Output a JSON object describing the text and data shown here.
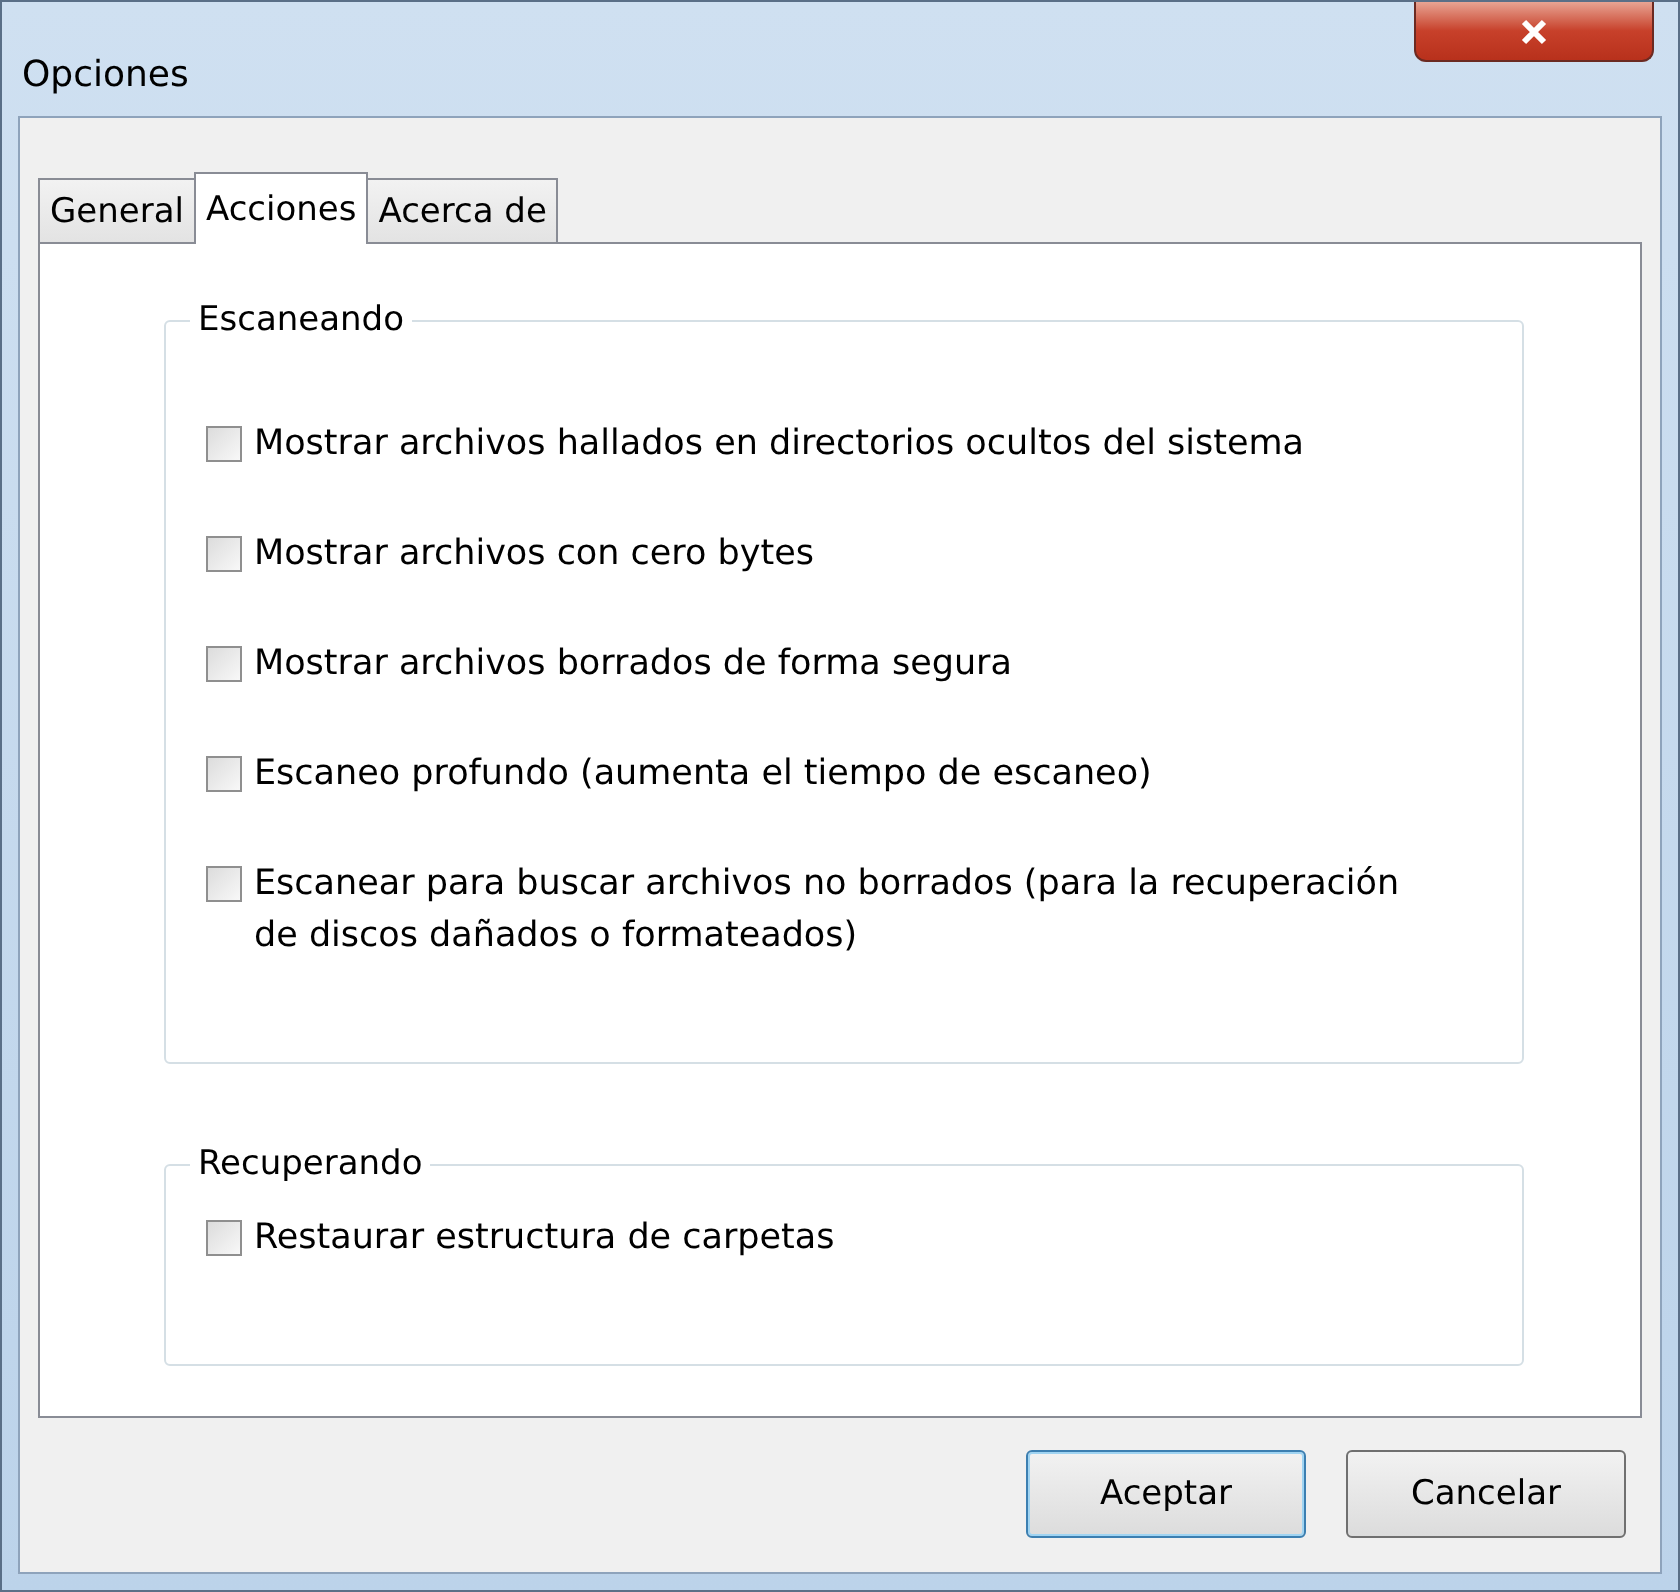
{
  "window": {
    "title": "Opciones"
  },
  "tabs": [
    {
      "label": "General",
      "selected": false
    },
    {
      "label": "Acciones",
      "selected": true
    },
    {
      "label": "Acerca de",
      "selected": false
    }
  ],
  "groups": [
    {
      "title": "Escaneando",
      "options": [
        {
          "label": "Mostrar archivos hallados en directorios ocultos del sistema",
          "checked": false
        },
        {
          "label": "Mostrar archivos con cero bytes",
          "checked": false
        },
        {
          "label": "Mostrar archivos borrados de forma segura",
          "checked": false
        },
        {
          "label": "Escaneo profundo (aumenta el tiempo de escaneo)",
          "checked": false
        },
        {
          "label": "Escanear para buscar archivos no borrados (para la recuperación de discos dañados o formateados)",
          "checked": false
        }
      ]
    },
    {
      "title": "Recuperando",
      "options": [
        {
          "label": "Restaurar estructura de carpetas",
          "checked": false
        }
      ]
    }
  ],
  "buttons": [
    {
      "label": "Aceptar",
      "default": true
    },
    {
      "label": "Cancelar",
      "default": false
    }
  ]
}
